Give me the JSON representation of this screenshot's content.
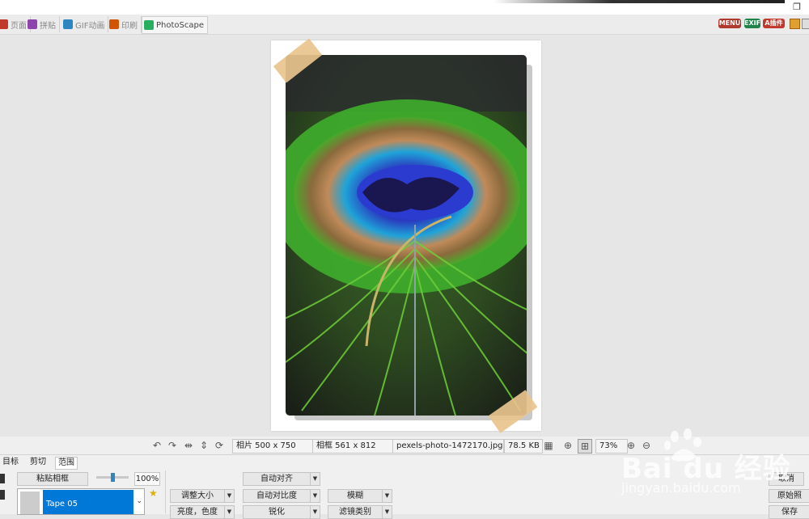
{
  "toolbar": {
    "tabs": [
      {
        "label": "页面",
        "color": "#c0392b"
      },
      {
        "label": "拼贴",
        "color": "#8e44ad"
      },
      {
        "label": "GIF动画",
        "color": "#2e86c1"
      },
      {
        "label": "印刷",
        "color": "#d35400"
      },
      {
        "label": "PhotoScape",
        "color": "#27ae60"
      }
    ],
    "right_buttons": [
      {
        "label": "MENU",
        "color": "#b03a2e"
      },
      {
        "label": "EXIF",
        "color": "#1e8449"
      },
      {
        "label": "A插件",
        "color": "#c0392b"
      }
    ]
  },
  "status": {
    "photo_size": "相片 500 x 750",
    "frame_size": "相框 561 x 812",
    "filename": "pexels-photo-1472170.jpg",
    "filesize": "78.5 KB",
    "zoom": "73%"
  },
  "panel": {
    "tabs": [
      "目标",
      "剪切",
      "范围"
    ],
    "paste_frame": "粘贴相框",
    "slider_value": "100%",
    "slider_level": 0.5,
    "frame_select": "Tape 05",
    "buttons": {
      "resize": "调整大小",
      "brightness": "亮度，色度",
      "auto_level": "自动对齐",
      "auto_contrast": "自动对比度",
      "sharpen": "锐化",
      "blur": "模糊",
      "filter": "滤镜类别",
      "cancel": "取消",
      "original": "原始照",
      "save": "保存"
    }
  },
  "watermark": {
    "brand": "Bai du 经验",
    "url": "jingyan.baidu.com"
  }
}
